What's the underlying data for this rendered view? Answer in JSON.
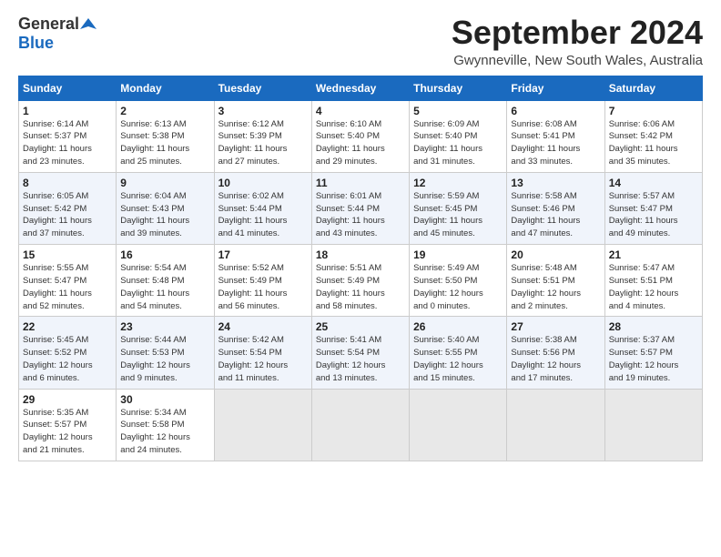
{
  "header": {
    "logo_line1": "General",
    "logo_line2": "Blue",
    "month_title": "September 2024",
    "location": "Gwynneville, New South Wales, Australia"
  },
  "calendar": {
    "days_of_week": [
      "Sunday",
      "Monday",
      "Tuesday",
      "Wednesday",
      "Thursday",
      "Friday",
      "Saturday"
    ],
    "weeks": [
      [
        {
          "day": "",
          "info": ""
        },
        {
          "day": "2",
          "info": "Sunrise: 6:13 AM\nSunset: 5:38 PM\nDaylight: 11 hours\nand 25 minutes."
        },
        {
          "day": "3",
          "info": "Sunrise: 6:12 AM\nSunset: 5:39 PM\nDaylight: 11 hours\nand 27 minutes."
        },
        {
          "day": "4",
          "info": "Sunrise: 6:10 AM\nSunset: 5:40 PM\nDaylight: 11 hours\nand 29 minutes."
        },
        {
          "day": "5",
          "info": "Sunrise: 6:09 AM\nSunset: 5:40 PM\nDaylight: 11 hours\nand 31 minutes."
        },
        {
          "day": "6",
          "info": "Sunrise: 6:08 AM\nSunset: 5:41 PM\nDaylight: 11 hours\nand 33 minutes."
        },
        {
          "day": "7",
          "info": "Sunrise: 6:06 AM\nSunset: 5:42 PM\nDaylight: 11 hours\nand 35 minutes."
        }
      ],
      [
        {
          "day": "8",
          "info": "Sunrise: 6:05 AM\nSunset: 5:42 PM\nDaylight: 11 hours\nand 37 minutes."
        },
        {
          "day": "9",
          "info": "Sunrise: 6:04 AM\nSunset: 5:43 PM\nDaylight: 11 hours\nand 39 minutes."
        },
        {
          "day": "10",
          "info": "Sunrise: 6:02 AM\nSunset: 5:44 PM\nDaylight: 11 hours\nand 41 minutes."
        },
        {
          "day": "11",
          "info": "Sunrise: 6:01 AM\nSunset: 5:44 PM\nDaylight: 11 hours\nand 43 minutes."
        },
        {
          "day": "12",
          "info": "Sunrise: 5:59 AM\nSunset: 5:45 PM\nDaylight: 11 hours\nand 45 minutes."
        },
        {
          "day": "13",
          "info": "Sunrise: 5:58 AM\nSunset: 5:46 PM\nDaylight: 11 hours\nand 47 minutes."
        },
        {
          "day": "14",
          "info": "Sunrise: 5:57 AM\nSunset: 5:47 PM\nDaylight: 11 hours\nand 49 minutes."
        }
      ],
      [
        {
          "day": "15",
          "info": "Sunrise: 5:55 AM\nSunset: 5:47 PM\nDaylight: 11 hours\nand 52 minutes."
        },
        {
          "day": "16",
          "info": "Sunrise: 5:54 AM\nSunset: 5:48 PM\nDaylight: 11 hours\nand 54 minutes."
        },
        {
          "day": "17",
          "info": "Sunrise: 5:52 AM\nSunset: 5:49 PM\nDaylight: 11 hours\nand 56 minutes."
        },
        {
          "day": "18",
          "info": "Sunrise: 5:51 AM\nSunset: 5:49 PM\nDaylight: 11 hours\nand 58 minutes."
        },
        {
          "day": "19",
          "info": "Sunrise: 5:49 AM\nSunset: 5:50 PM\nDaylight: 12 hours\nand 0 minutes."
        },
        {
          "day": "20",
          "info": "Sunrise: 5:48 AM\nSunset: 5:51 PM\nDaylight: 12 hours\nand 2 minutes."
        },
        {
          "day": "21",
          "info": "Sunrise: 5:47 AM\nSunset: 5:51 PM\nDaylight: 12 hours\nand 4 minutes."
        }
      ],
      [
        {
          "day": "22",
          "info": "Sunrise: 5:45 AM\nSunset: 5:52 PM\nDaylight: 12 hours\nand 6 minutes."
        },
        {
          "day": "23",
          "info": "Sunrise: 5:44 AM\nSunset: 5:53 PM\nDaylight: 12 hours\nand 9 minutes."
        },
        {
          "day": "24",
          "info": "Sunrise: 5:42 AM\nSunset: 5:54 PM\nDaylight: 12 hours\nand 11 minutes."
        },
        {
          "day": "25",
          "info": "Sunrise: 5:41 AM\nSunset: 5:54 PM\nDaylight: 12 hours\nand 13 minutes."
        },
        {
          "day": "26",
          "info": "Sunrise: 5:40 AM\nSunset: 5:55 PM\nDaylight: 12 hours\nand 15 minutes."
        },
        {
          "day": "27",
          "info": "Sunrise: 5:38 AM\nSunset: 5:56 PM\nDaylight: 12 hours\nand 17 minutes."
        },
        {
          "day": "28",
          "info": "Sunrise: 5:37 AM\nSunset: 5:57 PM\nDaylight: 12 hours\nand 19 minutes."
        }
      ],
      [
        {
          "day": "29",
          "info": "Sunrise: 5:35 AM\nSunset: 5:57 PM\nDaylight: 12 hours\nand 21 minutes."
        },
        {
          "day": "30",
          "info": "Sunrise: 5:34 AM\nSunset: 5:58 PM\nDaylight: 12 hours\nand 24 minutes."
        },
        {
          "day": "",
          "info": ""
        },
        {
          "day": "",
          "info": ""
        },
        {
          "day": "",
          "info": ""
        },
        {
          "day": "",
          "info": ""
        },
        {
          "day": "",
          "info": ""
        }
      ]
    ],
    "week0_day1": "1",
    "week0_day1_info": "Sunrise: 6:14 AM\nSunset: 5:37 PM\nDaylight: 11 hours\nand 23 minutes."
  }
}
